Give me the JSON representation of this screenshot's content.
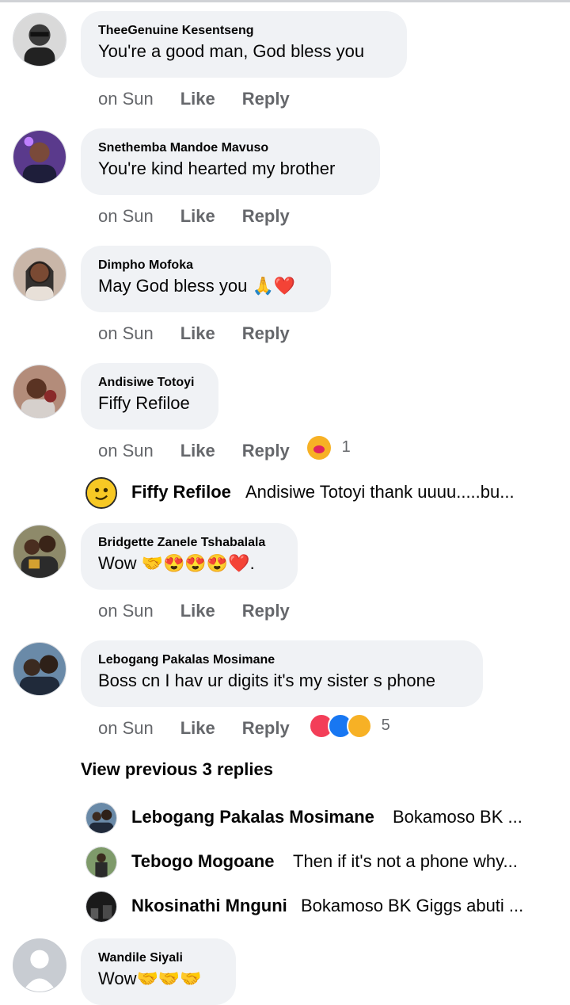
{
  "comments": [
    {
      "author": "TheeGenuine Kesentseng",
      "text": "You're a good man, God bless you",
      "time": "on Sun",
      "like": "Like",
      "reply": "Reply"
    },
    {
      "author": "Snethemba Mandoe Mavuso",
      "text": "You're kind hearted my brother",
      "time": "on Sun",
      "like": "Like",
      "reply": "Reply"
    },
    {
      "author": "Dimpho Mofoka",
      "text": "May God bless you",
      "text_emoji": "🙏❤️",
      "time": "on Sun",
      "like": "Like",
      "reply": "Reply"
    },
    {
      "author": "Andisiwe Totoyi",
      "text": "Fiffy Refiloe",
      "time": "on Sun",
      "like": "Like",
      "reply": "Reply",
      "reaction_count": "1"
    },
    {
      "author": "Bridgette Zanele Tshabalala",
      "text": "Wow",
      "text_emoji": "🤝😍😍😍❤️.",
      "time": "on Sun",
      "like": "Like",
      "reply": "Reply"
    },
    {
      "author": "Lebogang Pakalas Mosimane",
      "text": "Boss cn I hav ur digits it's my sister s phone",
      "time": "on Sun",
      "like": "Like",
      "reply": "Reply",
      "reaction_count": "5"
    },
    {
      "author": "Wandile Siyali",
      "text": "Wow",
      "text_emoji": "🤝🤝🤝"
    }
  ],
  "reply_fiffy": {
    "author": "Fiffy Refiloe",
    "text": "Andisiwe Totoyi thank uuuu.....bu..."
  },
  "view_previous": "View previous 3 replies",
  "replies": [
    {
      "author": "Lebogang Pakalas Mosimane",
      "text": "Bokamoso BK ..."
    },
    {
      "author": "Tebogo Mogoane",
      "text": "Then if it's not a phone why..."
    },
    {
      "author": "Nkosinathi Mnguni",
      "text": "Bokamoso BK Giggs abuti ..."
    }
  ],
  "colors": {
    "bubble": "#f0f2f5",
    "meta": "#65676b",
    "text": "#050505"
  }
}
